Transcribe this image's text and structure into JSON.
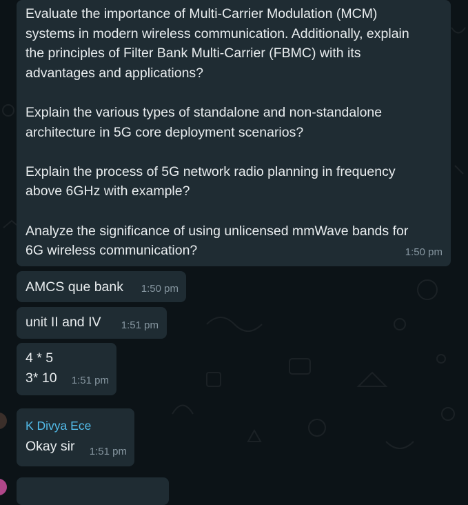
{
  "chat": {
    "messages": [
      {
        "text": "Evaluate the importance of Multi-Carrier Modulation (MCM)\nsystems in modern wireless communication. Additionally, explain\nthe principles of Filter Bank Multi-Carrier (FBMC) with its\nadvantages and applications?\n\nExplain the various types of standalone and non-standalone\narchitecture in 5G core deployment scenarios?\n\nExplain the process of 5G network radio planning in frequency\nabove 6GHz with example?\n\nAnalyze the significance of using unlicensed mmWave bands for\n6G wireless communication?",
        "time": "1:50 pm"
      },
      {
        "text": "AMCS que bank",
        "time": "1:50 pm"
      },
      {
        "text": "unit II and IV",
        "time": "1:51 pm"
      },
      {
        "text": "4 * 5\n3* 10",
        "time": "1:51 pm"
      },
      {
        "sender": "K Divya Ece",
        "text": "Okay sir",
        "time": "1:51 pm"
      }
    ]
  },
  "colors": {
    "background": "#0c1317",
    "bubble": "#1f2c33",
    "text": "#e9edef",
    "timestamp": "#8696a0",
    "sender_name": "#53bdeb"
  }
}
